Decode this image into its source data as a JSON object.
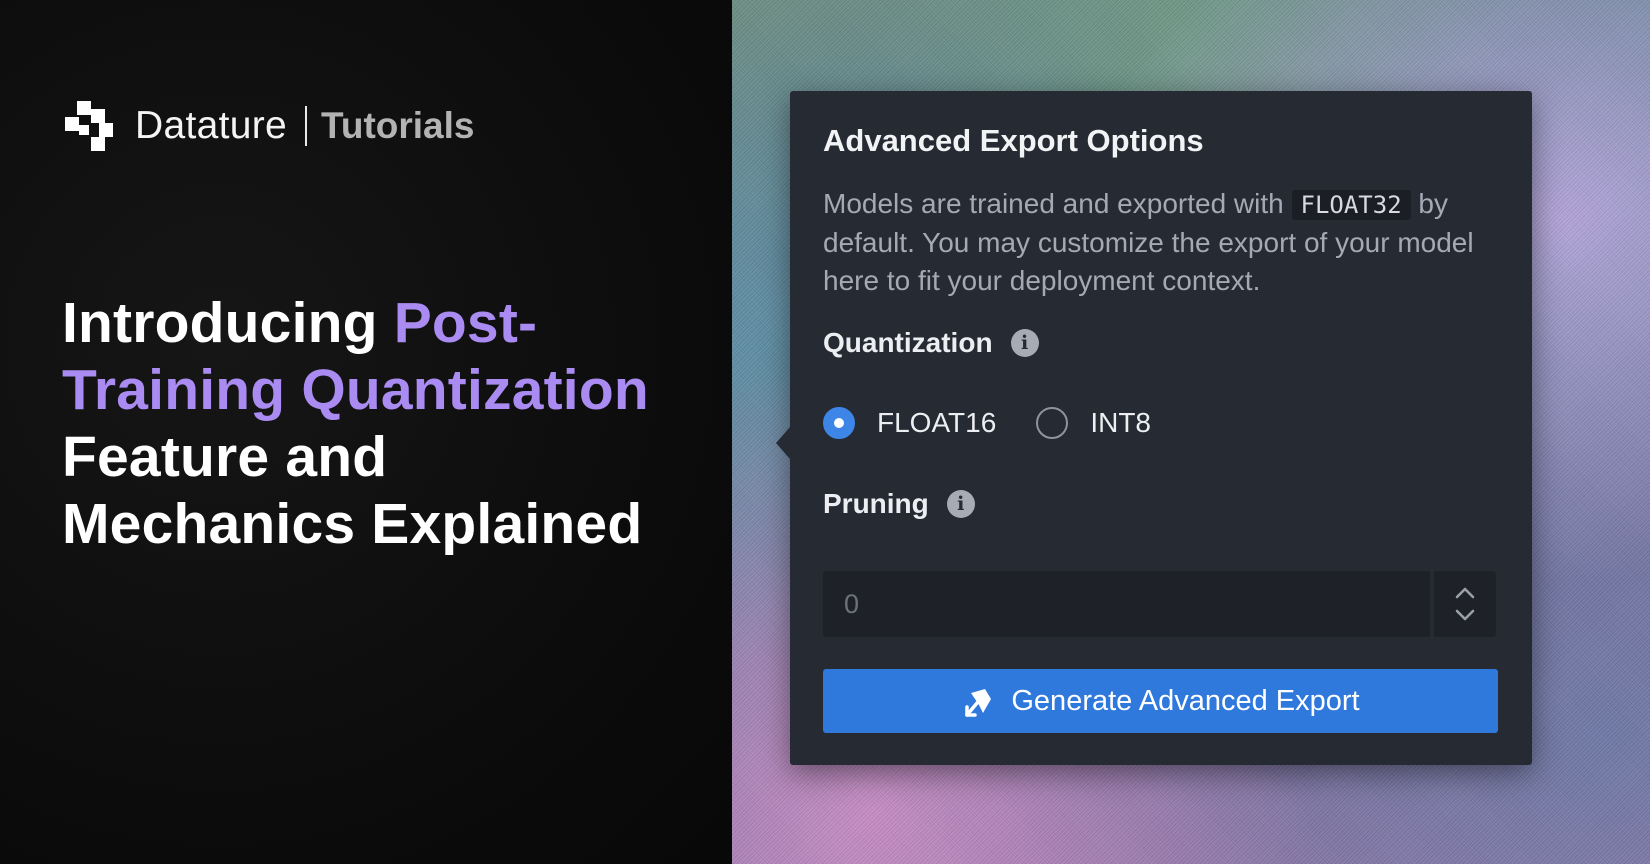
{
  "brand": {
    "name": "Datature",
    "section": "Tutorials"
  },
  "headline": {
    "part1": "Introducing ",
    "accent1": "Post-",
    "accent2": "Training Quantization",
    "part2": "Feature and",
    "part3": "Mechanics Explained"
  },
  "panel": {
    "title": "Advanced Export Options",
    "description_before": "Models are trained and exported with ",
    "description_code": "FLOAT32",
    "description_after": " by default. You may customize the export of your model here to fit your deployment context.",
    "quantization": {
      "label": "Quantization",
      "options": [
        {
          "label": "FLOAT16",
          "selected": true
        },
        {
          "label": "INT8",
          "selected": false
        }
      ]
    },
    "pruning": {
      "label": "Pruning",
      "value": "0"
    },
    "export_button_label": "Generate Advanced Export"
  },
  "colors": {
    "accent_purple": "#a98bf1",
    "button_blue": "#2f78dc",
    "radio_blue": "#3d86e8",
    "panel_bg": "#262a33"
  },
  "icons": [
    "datature-logo-icon",
    "info-icon",
    "chevron-up-icon",
    "chevron-down-icon",
    "export-arrow-icon"
  ]
}
